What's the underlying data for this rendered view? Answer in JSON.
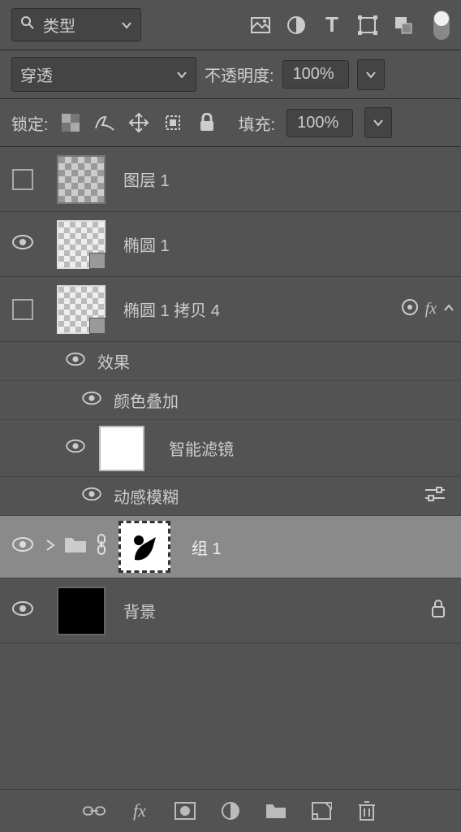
{
  "filter": {
    "label": "类型"
  },
  "blend": {
    "mode": "穿透",
    "opacity_label": "不透明度:",
    "opacity_value": "100%"
  },
  "lock": {
    "label": "锁定:",
    "fill_label": "填充:",
    "fill_value": "100%"
  },
  "layers": {
    "items": [
      {
        "name": "图层 1"
      },
      {
        "name": "椭圆 1"
      },
      {
        "name": "椭圆 1 拷贝 4"
      },
      {
        "name": "组 1"
      },
      {
        "name": "背景"
      }
    ]
  },
  "effects": {
    "heading": "效果",
    "color_overlay": "颜色叠加",
    "smart_filter": "智能滤镜",
    "motion_blur": "动感模糊"
  },
  "fx_label": "fx"
}
